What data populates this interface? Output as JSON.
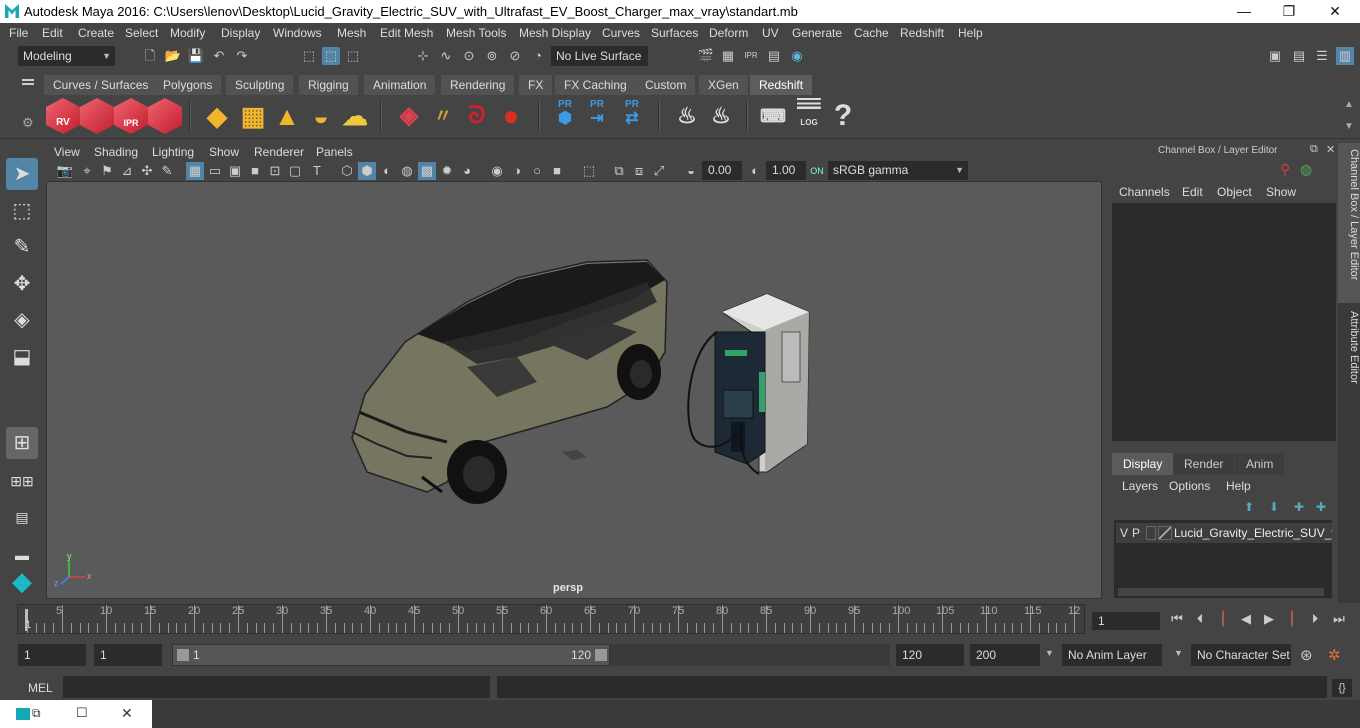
{
  "app": {
    "title": "Autodesk Maya 2016: C:\\Users\\lenov\\Desktop\\Lucid_Gravity_Electric_SUV_with_Ultrafast_EV_Boost_Charger_max_vray\\standart.mb",
    "window_controls": [
      "—",
      "❐",
      "✕"
    ]
  },
  "menubar": [
    "File",
    "Edit",
    "Create",
    "Select",
    "Modify",
    "Display",
    "Windows",
    "Mesh",
    "Edit Mesh",
    "Mesh Tools",
    "Mesh Display",
    "Curves",
    "Surfaces",
    "Deform",
    "UV",
    "Generate",
    "Cache",
    "Redshift",
    "Help"
  ],
  "statusline": {
    "mode": "Modeling",
    "live_surface": "No Live Surface"
  },
  "shelf": {
    "tabs": [
      "Curves / Surfaces",
      "Polygons",
      "Sculpting",
      "Rigging",
      "Animation",
      "Rendering",
      "FX",
      "FX Caching",
      "Custom",
      "XGen",
      "Redshift"
    ],
    "active_tab": "Redshift",
    "icon_labels": {
      "rv": "RV",
      "ipr": "IPR",
      "pr1": "PR",
      "pr2": "PR",
      "pr3": "PR",
      "log": "LOG",
      "help": "?"
    }
  },
  "viewport": {
    "menu": [
      "View",
      "Shading",
      "Lighting",
      "Show",
      "Renderer",
      "Panels"
    ],
    "exposure": "0.00",
    "gamma": "1.00",
    "color_space": "sRGB gamma",
    "camera_label": "persp",
    "axis": {
      "x": "x",
      "y": "y",
      "z": "z"
    }
  },
  "channel_box": {
    "header": "Channel Box / Layer Editor",
    "menu": [
      "Channels",
      "Edit",
      "Object",
      "Show"
    ],
    "side_tabs": [
      "Channel Box / Layer Editor",
      "Attribute Editor"
    ]
  },
  "layer_editor": {
    "tabs": [
      "Display",
      "Render",
      "Anim"
    ],
    "active_tab": "Display",
    "menu": [
      "Layers",
      "Options",
      "Help"
    ],
    "layers": [
      {
        "v": "V",
        "p": "P",
        "name": "Lucid_Gravity_Electric_SUV_with"
      }
    ]
  },
  "timeline": {
    "ticks": [
      "5",
      "10",
      "15",
      "20",
      "25",
      "30",
      "35",
      "40",
      "45",
      "50",
      "55",
      "60",
      "65",
      "70",
      "75",
      "80",
      "85",
      "90",
      "95",
      "100",
      "105",
      "110",
      "115",
      "12"
    ],
    "first_frame": "1",
    "current_frame": "1"
  },
  "range": {
    "start": "1",
    "playback_start": "1",
    "slider_start": "1",
    "slider_end": "120",
    "playback_end": "120",
    "end": "200",
    "anim_layer": "No Anim Layer",
    "character_set": "No Character Set"
  },
  "command_line": {
    "label": "MEL"
  },
  "colors": {
    "panel": "#444444",
    "field": "#2b2b2b",
    "viewport": "#5a5a5a",
    "redshift_red": "#d8323c",
    "accent_blue": "#3d8fd6",
    "maya_teal": "#1fb8c7"
  }
}
